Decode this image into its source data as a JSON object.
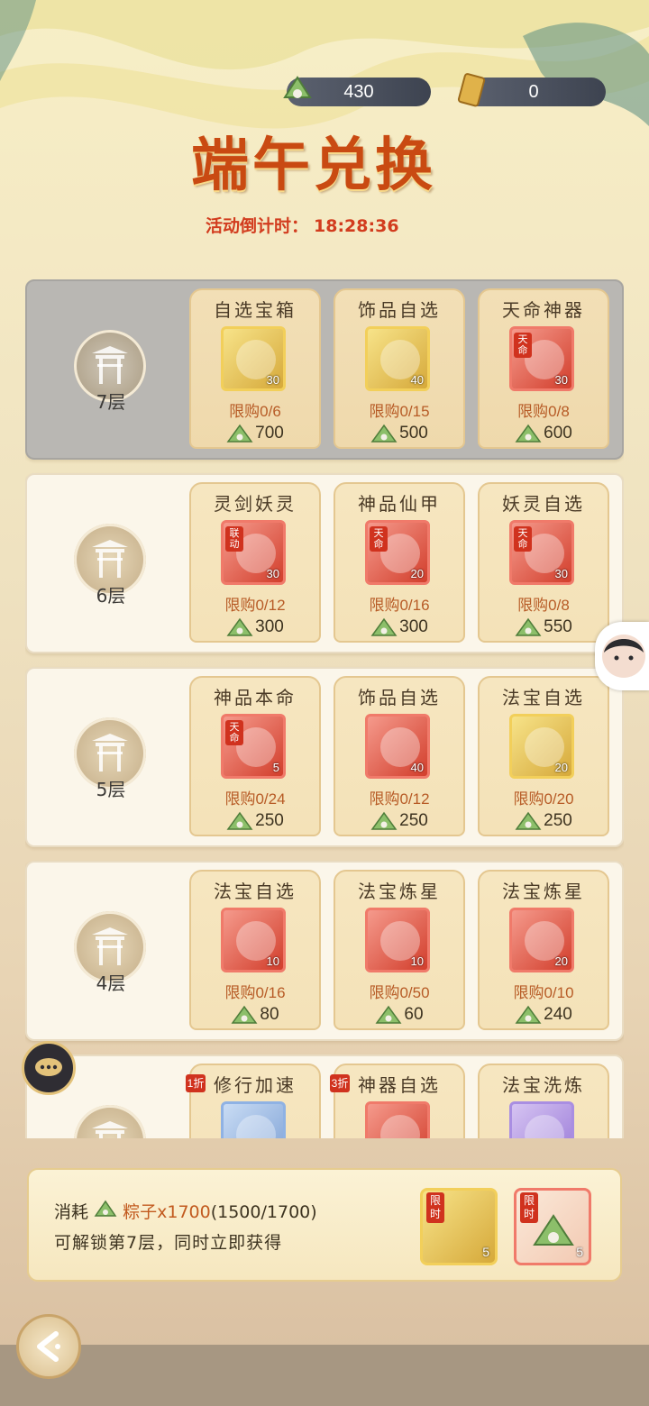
{
  "currency": {
    "zongzi": "430",
    "ticket": "0"
  },
  "title": "端午兑换",
  "countdown": {
    "label": "活动倒计时：",
    "time": "18:28:36"
  },
  "tiers": [
    {
      "label": "7层",
      "locked": true,
      "items": [
        {
          "name": "自选宝箱",
          "qty": "30",
          "limit": "限购0/6",
          "cost": "700",
          "color": "gold"
        },
        {
          "name": "饰品自选",
          "qty": "40",
          "limit": "限购0/15",
          "cost": "500",
          "color": "gold"
        },
        {
          "name": "天命神器",
          "qty": "30",
          "limit": "限购0/8",
          "cost": "600",
          "color": "red",
          "tag": "天命"
        }
      ]
    },
    {
      "label": "6层",
      "locked": false,
      "items": [
        {
          "name": "灵剑妖灵",
          "qty": "30",
          "limit": "限购0/12",
          "cost": "300",
          "color": "red",
          "tag": "联动"
        },
        {
          "name": "神品仙甲",
          "qty": "20",
          "limit": "限购0/16",
          "cost": "300",
          "color": "red",
          "tag": "天命"
        },
        {
          "name": "妖灵自选",
          "qty": "30",
          "limit": "限购0/8",
          "cost": "550",
          "color": "red",
          "tag": "天命"
        }
      ]
    },
    {
      "label": "5层",
      "locked": false,
      "items": [
        {
          "name": "神品本命",
          "qty": "5",
          "limit": "限购0/24",
          "cost": "250",
          "color": "red",
          "tag": "天命"
        },
        {
          "name": "饰品自选",
          "qty": "40",
          "limit": "限购0/12",
          "cost": "250",
          "color": "red"
        },
        {
          "name": "法宝自选",
          "qty": "20",
          "limit": "限购0/20",
          "cost": "250",
          "color": "gold"
        }
      ]
    },
    {
      "label": "4层",
      "locked": false,
      "items": [
        {
          "name": "法宝自选",
          "qty": "10",
          "limit": "限购0/16",
          "cost": "80",
          "color": "red"
        },
        {
          "name": "法宝炼星",
          "qty": "10",
          "limit": "限购0/50",
          "cost": "60",
          "color": "red"
        },
        {
          "name": "法宝炼星",
          "qty": "20",
          "limit": "限购0/10",
          "cost": "240",
          "color": "red"
        }
      ]
    },
    {
      "label": "",
      "locked": false,
      "items": [
        {
          "name": "修行加速",
          "discount": "1折",
          "color": "blue"
        },
        {
          "name": "神器自选",
          "discount": "3折",
          "color": "red"
        },
        {
          "name": "法宝洗炼",
          "color": "purple"
        }
      ]
    }
  ],
  "unlock": {
    "prefix": "消耗",
    "item": "粽子x1700",
    "progress": "(1500/1700)",
    "line2": "可解锁第7层，同时立即获得",
    "rewards": [
      {
        "tag": "限时",
        "qty": "5"
      },
      {
        "tag": "限时",
        "qty": "5"
      }
    ]
  }
}
